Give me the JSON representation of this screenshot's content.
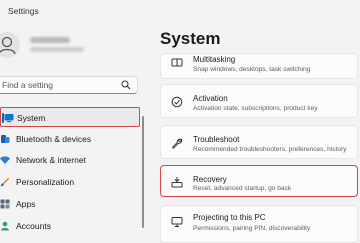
{
  "window": {
    "title": "Settings"
  },
  "search": {
    "placeholder": "Find a setting"
  },
  "sidebar": {
    "items": [
      {
        "label": "System"
      },
      {
        "label": "Bluetooth & devices"
      },
      {
        "label": "Network & internet"
      },
      {
        "label": "Personalization"
      },
      {
        "label": "Apps"
      },
      {
        "label": "Accounts"
      }
    ]
  },
  "main": {
    "title": "System",
    "cards": [
      {
        "title": "Multitasking",
        "description": "Snap windows, desktops, task switching"
      },
      {
        "title": "Activation",
        "description": "Activation state, subscriptions, product key"
      },
      {
        "title": "Troubleshoot",
        "description": "Recommended troubleshooters, preferences, history"
      },
      {
        "title": "Recovery",
        "description": "Reset, advanced startup, go back"
      },
      {
        "title": "Projecting to this PC",
        "description": "Permissions, pairing PIN, discoverability"
      }
    ]
  },
  "colors": {
    "accent": "#0067c0",
    "highlight": "#d64545"
  }
}
